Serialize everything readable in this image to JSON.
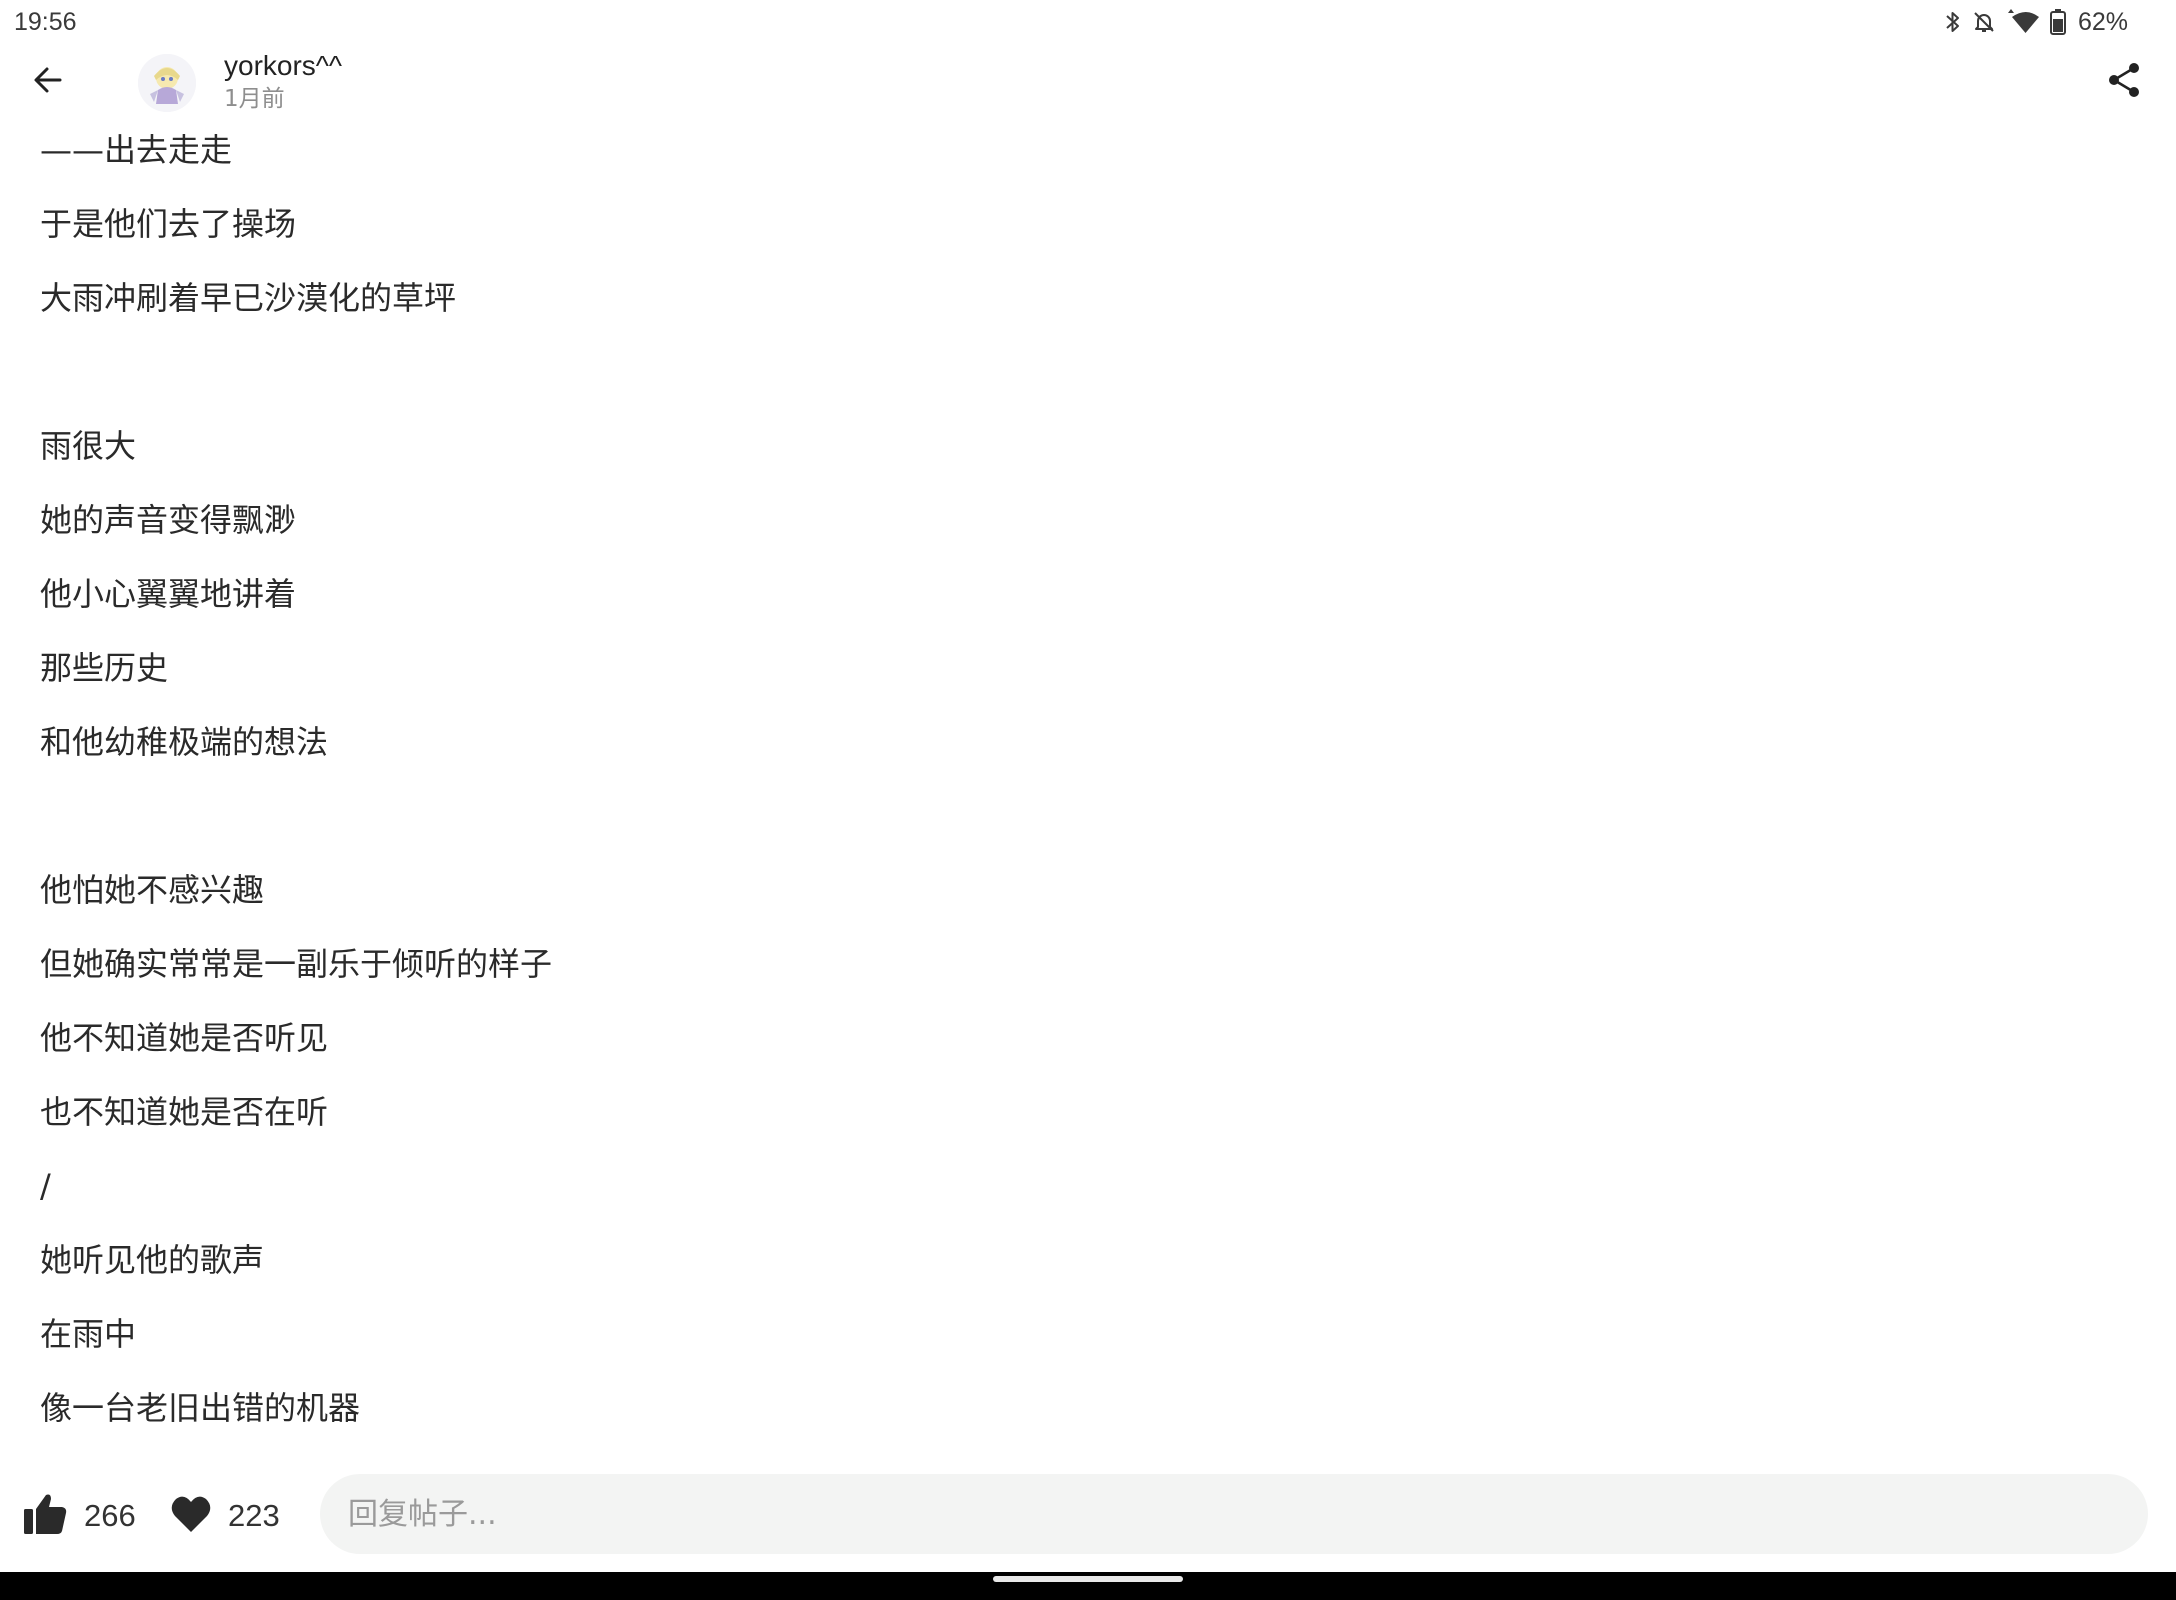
{
  "status_bar": {
    "time": "19:56",
    "battery": "62%",
    "icons": [
      "bluetooth-icon",
      "notifications-off-icon",
      "data-arrows-icon",
      "wifi-icon",
      "battery-icon"
    ]
  },
  "header": {
    "author": "yorkors^^",
    "time_ago": "1月前",
    "icons": [
      "back-arrow-icon",
      "share-icon"
    ]
  },
  "post": {
    "lines": [
      "——出去走走",
      "于是他们去了操场",
      "大雨冲刷着早已沙漠化的草坪",
      "",
      "雨很大",
      "她的声音变得飘渺",
      "他小心翼翼地讲着",
      "那些历史",
      "和他幼稚极端的想法",
      "",
      "他怕她不感兴趣",
      "但她确实常常是一副乐于倾听的样子",
      "他不知道她是否听见",
      "也不知道她是否在听",
      "/",
      "她听见他的歌声",
      "在雨中",
      "像一台老旧出错的机器"
    ]
  },
  "actions": {
    "likes": "266",
    "favorites": "223",
    "reply_placeholder": "回复帖子..."
  },
  "colors": {
    "background": "#ffffff",
    "text": "#2a2a2a",
    "muted": "#8e8e8e",
    "input_bg": "#f3f4f3",
    "nav_bar": "#000000"
  }
}
